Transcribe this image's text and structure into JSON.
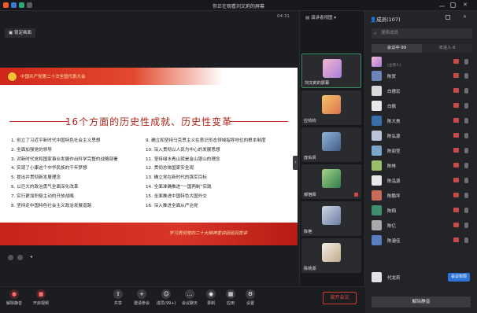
{
  "window": {
    "title": "你正在观看刘文莉的屏幕"
  },
  "topbar": {
    "time": "04:31"
  },
  "stage": {
    "lock_label": "锁定画面"
  },
  "slide": {
    "congress": "中国共产党第二十次全国代表大会",
    "title": "16个方面的历史性成就、历史性变革",
    "left_items": [
      "1. 创立了习近平新时代中国特色社会主义思想",
      "2. 全面加强党的领导",
      "3. 对新时代党和国家事业发展作出科学完整的战略部署",
      "4. 实现了小康这个中华民族的千年梦想",
      "5. 提出并贯彻新发展理念",
      "6. 以巨大的政治勇气全面深化改革",
      "7. 实行更加积极主动的开放战略",
      "8. 坚持走中国特色社会主义政治发展道路"
    ],
    "right_items": [
      "9. 确立和坚持马克思主义在意识形态领域指导地位的根本制度",
      "10. 深入贯彻以人民为中心的发展思想",
      "11. 坚持绿水青山就是金山银山的理念",
      "12. 贯彻总体国家安全观",
      "13. 确立党在新时代的强军目标",
      "14. 全面准确推进“一国两制”实践",
      "15. 全面推进中国特色大国外交",
      "16. 深入推进全面从严治党"
    ],
    "slogan": "学习贯彻党的二十大精神宣讲团巡回宣讲"
  },
  "gallery": {
    "tab_label": "演讲者视图",
    "tiles": [
      {
        "name": "刘文莉的屏幕"
      },
      {
        "name": "应钧钧"
      },
      {
        "name": "庞佑贤"
      },
      {
        "name": "郝宿霖"
      },
      {
        "name": "陈艳"
      },
      {
        "name": "陈杨源"
      }
    ]
  },
  "panel": {
    "title": "成员(107)",
    "search_placeholder": "搜索成员",
    "tab_in_meeting": "会议中·99",
    "tab_not_joined": "未进入·8",
    "host_role": "(主持人)",
    "members": [
      "",
      "陈贺",
      "白德宏",
      "白振",
      "陈大美",
      "陈弘源",
      "陈丽莹",
      "陈林",
      "陈泓源",
      "陈鹏坪",
      "陈翔",
      "陈亿",
      "陈涵佳",
      "代龙莉"
    ],
    "unmute_me_label": "会议权限",
    "unmute_all_label": "解除静音"
  },
  "toolbar": {
    "buttons": [
      {
        "label": "解除静音",
        "icon": "mic-icon"
      },
      {
        "label": "开启视频",
        "icon": "video-icon"
      },
      {
        "label": "共享",
        "icon": "share-icon"
      },
      {
        "label": "邀请参会",
        "icon": "invite-icon"
      },
      {
        "label": "成员(99+)",
        "icon": "members-icon"
      },
      {
        "label": "会议聊天",
        "icon": "chat-icon"
      },
      {
        "label": "录制",
        "icon": "record-icon"
      },
      {
        "label": "应用",
        "icon": "apps-icon"
      },
      {
        "label": "设置",
        "icon": "settings-icon"
      }
    ],
    "end_label": "离开会议"
  }
}
